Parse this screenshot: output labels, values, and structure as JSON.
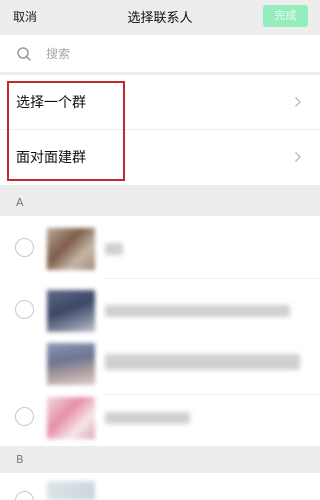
{
  "navbar": {
    "cancel_label": "取消",
    "title": "选择联系人",
    "done_label": "完成"
  },
  "search": {
    "placeholder": "搜索",
    "icon": "search-icon"
  },
  "options": [
    {
      "label": "选择一个群"
    },
    {
      "label": "面对面建群"
    }
  ],
  "sections": [
    {
      "letter": "A"
    },
    {
      "letter": "B"
    }
  ],
  "colors": {
    "done_button": "#95ecbd",
    "highlight_box": "#c8282c",
    "background": "#ededed"
  }
}
